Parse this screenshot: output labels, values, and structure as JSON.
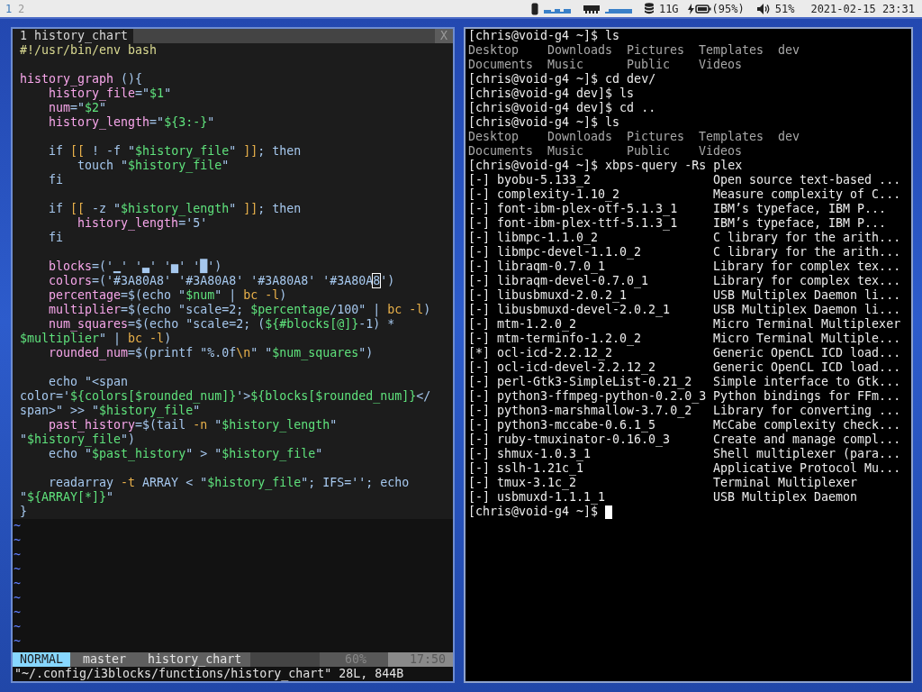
{
  "status_bar": {
    "workspaces": [
      {
        "label": "1",
        "selected": true
      },
      {
        "label": "2",
        "selected": false
      }
    ],
    "disk": "11G",
    "battery": "(95%)",
    "volume": "51%",
    "clock": "2021-02-15 23:31"
  },
  "vim": {
    "tabs": [
      {
        "label": "1 history_chart",
        "selected": true
      }
    ],
    "close": "X",
    "lines": [
      {
        "kind": "code",
        "segments": [
          {
            "kind": "shebang",
            "text": "#!/usr/bin/env bash"
          }
        ]
      },
      {
        "kind": "blank"
      },
      {
        "kind": "code",
        "segments": [
          {
            "kind": "name",
            "text": "history_graph"
          },
          {
            "kind": "plain",
            "text": " (){"
          }
        ]
      },
      {
        "kind": "code",
        "segments": [
          {
            "kind": "name",
            "text": "    history_file"
          },
          {
            "kind": "plain",
            "text": "=\""
          },
          {
            "kind": "string",
            "text": "$1"
          },
          {
            "kind": "plain",
            "text": "\""
          }
        ]
      },
      {
        "kind": "code",
        "segments": [
          {
            "kind": "name",
            "text": "    num"
          },
          {
            "kind": "plain",
            "text": "=\""
          },
          {
            "kind": "string",
            "text": "$2"
          },
          {
            "kind": "plain",
            "text": "\""
          }
        ]
      },
      {
        "kind": "code",
        "segments": [
          {
            "kind": "name",
            "text": "    history_length"
          },
          {
            "kind": "plain",
            "text": "=\""
          },
          {
            "kind": "string",
            "text": "${3:-}"
          },
          {
            "kind": "plain",
            "text": "\""
          }
        ]
      },
      {
        "kind": "blank"
      },
      {
        "kind": "code",
        "segments": [
          {
            "kind": "plain",
            "text": "    if "
          },
          {
            "kind": "flag",
            "text": "[["
          },
          {
            "kind": "plain",
            "text": " ! -f \""
          },
          {
            "kind": "string",
            "text": "$history_file"
          },
          {
            "kind": "plain",
            "text": "\" "
          },
          {
            "kind": "flag",
            "text": "]]"
          },
          {
            "kind": "plain",
            "text": "; then"
          }
        ]
      },
      {
        "kind": "code",
        "segments": [
          {
            "kind": "plain",
            "text": "        touch \""
          },
          {
            "kind": "string",
            "text": "$history_file"
          },
          {
            "kind": "plain",
            "text": "\""
          }
        ]
      },
      {
        "kind": "code",
        "segments": [
          {
            "kind": "plain",
            "text": "    fi"
          }
        ]
      },
      {
        "kind": "blank"
      },
      {
        "kind": "code",
        "segments": [
          {
            "kind": "plain",
            "text": "    if "
          },
          {
            "kind": "flag",
            "text": "[["
          },
          {
            "kind": "plain",
            "text": " -z \""
          },
          {
            "kind": "string",
            "text": "$history_length"
          },
          {
            "kind": "plain",
            "text": "\" "
          },
          {
            "kind": "flag",
            "text": "]]"
          },
          {
            "kind": "plain",
            "text": "; then"
          }
        ]
      },
      {
        "kind": "code",
        "segments": [
          {
            "kind": "name",
            "text": "        history_length"
          },
          {
            "kind": "plain",
            "text": "='5'"
          }
        ]
      },
      {
        "kind": "code",
        "segments": [
          {
            "kind": "plain",
            "text": "    fi"
          }
        ]
      },
      {
        "kind": "blank"
      },
      {
        "kind": "code",
        "segments": [
          {
            "kind": "name",
            "text": "    blocks"
          },
          {
            "kind": "plain",
            "text": "=('▁' '▃' '▅' '█')"
          }
        ]
      },
      {
        "kind": "code",
        "segments": [
          {
            "kind": "name",
            "text": "    colors"
          },
          {
            "kind": "plain",
            "text": "=('#3A80A8' '#3A80A8' '#3A80A8' '#3A80A"
          },
          {
            "kind": "cursor",
            "text": "8"
          },
          {
            "kind": "plain",
            "text": "')"
          }
        ]
      },
      {
        "kind": "code",
        "segments": [
          {
            "kind": "name",
            "text": "    percentage"
          },
          {
            "kind": "plain",
            "text": "=$(echo \""
          },
          {
            "kind": "string",
            "text": "$num"
          },
          {
            "kind": "plain",
            "text": "\" | "
          },
          {
            "kind": "flag",
            "text": "bc -l"
          },
          {
            "kind": "plain",
            "text": ")"
          }
        ]
      },
      {
        "kind": "code",
        "segments": [
          {
            "kind": "name",
            "text": "    multiplier"
          },
          {
            "kind": "plain",
            "text": "=$(echo \"scale=2; "
          },
          {
            "kind": "string",
            "text": "$percentage"
          },
          {
            "kind": "plain",
            "text": "/100\" | "
          },
          {
            "kind": "flag",
            "text": "bc -l"
          },
          {
            "kind": "plain",
            "text": ")"
          }
        ]
      },
      {
        "kind": "code",
        "segments": [
          {
            "kind": "name",
            "text": "    num_squares"
          },
          {
            "kind": "plain",
            "text": "=$(echo \"scale=2; ("
          },
          {
            "kind": "string",
            "text": "${#blocks[@]}"
          },
          {
            "kind": "plain",
            "text": "-1) *"
          }
        ]
      },
      {
        "kind": "code",
        "segments": [
          {
            "kind": "string",
            "text": "$multiplier"
          },
          {
            "kind": "plain",
            "text": "\" | "
          },
          {
            "kind": "flag",
            "text": "bc -l"
          },
          {
            "kind": "plain",
            "text": ")"
          }
        ]
      },
      {
        "kind": "code",
        "segments": [
          {
            "kind": "name",
            "text": "    rounded_num"
          },
          {
            "kind": "plain",
            "text": "=$(printf \"%.0f"
          },
          {
            "kind": "flag",
            "text": "\\n"
          },
          {
            "kind": "plain",
            "text": "\" \""
          },
          {
            "kind": "string",
            "text": "$num_squares"
          },
          {
            "kind": "plain",
            "text": "\")"
          }
        ]
      },
      {
        "kind": "blank"
      },
      {
        "kind": "code",
        "segments": [
          {
            "kind": "plain",
            "text": "    echo \"<span"
          }
        ]
      },
      {
        "kind": "code",
        "segments": [
          {
            "kind": "plain",
            "text": "color='"
          },
          {
            "kind": "string",
            "text": "${colors[$rounded_num]}"
          },
          {
            "kind": "plain",
            "text": "'>"
          },
          {
            "kind": "string",
            "text": "${blocks[$rounded_num]}"
          },
          {
            "kind": "plain",
            "text": "</"
          }
        ]
      },
      {
        "kind": "code",
        "segments": [
          {
            "kind": "plain",
            "text": "span>\" >> \""
          },
          {
            "kind": "string",
            "text": "$history_file"
          },
          {
            "kind": "plain",
            "text": "\""
          }
        ]
      },
      {
        "kind": "code",
        "segments": [
          {
            "kind": "name",
            "text": "    past_history"
          },
          {
            "kind": "plain",
            "text": "=$(tail "
          },
          {
            "kind": "flag",
            "text": "-n"
          },
          {
            "kind": "plain",
            "text": " \""
          },
          {
            "kind": "string",
            "text": "$history_length"
          },
          {
            "kind": "plain",
            "text": "\""
          }
        ]
      },
      {
        "kind": "code",
        "segments": [
          {
            "kind": "plain",
            "text": "\""
          },
          {
            "kind": "string",
            "text": "$history_file"
          },
          {
            "kind": "plain",
            "text": "\")"
          }
        ]
      },
      {
        "kind": "code",
        "segments": [
          {
            "kind": "plain",
            "text": "    echo \""
          },
          {
            "kind": "string",
            "text": "$past_history"
          },
          {
            "kind": "plain",
            "text": "\" > \""
          },
          {
            "kind": "string",
            "text": "$history_file"
          },
          {
            "kind": "plain",
            "text": "\""
          }
        ]
      },
      {
        "kind": "blank"
      },
      {
        "kind": "code",
        "segments": [
          {
            "kind": "plain",
            "text": "    readarray "
          },
          {
            "kind": "flag",
            "text": "-t"
          },
          {
            "kind": "plain",
            "text": " ARRAY < \""
          },
          {
            "kind": "string",
            "text": "$history_file"
          },
          {
            "kind": "plain",
            "text": "\"; IFS=''; echo"
          }
        ]
      },
      {
        "kind": "code",
        "segments": [
          {
            "kind": "plain",
            "text": "\""
          },
          {
            "kind": "string",
            "text": "${ARRAY[*]}"
          },
          {
            "kind": "plain",
            "text": "\""
          }
        ]
      },
      {
        "kind": "code",
        "segments": [
          {
            "kind": "plain",
            "text": "}"
          }
        ]
      }
    ],
    "filler": [
      "~",
      "~",
      "~",
      "~",
      "~",
      "~",
      "~",
      "~",
      "~"
    ],
    "status_line": {
      "mode": "NORMAL",
      "branch": "master",
      "file": "history_chart",
      "percent": "60%",
      "position": "17:50"
    },
    "message": "\"~/.config/i3blocks/functions/history_chart\" 28L, 844B"
  },
  "terminal": {
    "output": [
      {
        "kind": "prompt",
        "text": "[chris@void-g4 ~]$ ls",
        "cursor": false
      },
      {
        "kind": "listing",
        "rows": [
          [
            "Desktop",
            "Downloads",
            "Pictures",
            "Templates",
            "dev"
          ],
          [
            "Documents",
            "Music",
            "Public",
            "Videos"
          ]
        ]
      },
      {
        "kind": "prompt",
        "text": "[chris@void-g4 ~]$ cd dev/",
        "cursor": false
      },
      {
        "kind": "prompt",
        "text": "[chris@void-g4 dev]$ ls",
        "cursor": false
      },
      {
        "kind": "prompt",
        "text": "[chris@void-g4 dev]$ cd ..",
        "cursor": false
      },
      {
        "kind": "prompt",
        "text": "[chris@void-g4 ~]$ ls",
        "cursor": false
      },
      {
        "kind": "listing",
        "rows": [
          [
            "Desktop",
            "Downloads",
            "Pictures",
            "Templates",
            "dev"
          ],
          [
            "Documents",
            "Music",
            "Public",
            "Videos"
          ]
        ]
      },
      {
        "kind": "prompt",
        "text": "[chris@void-g4 ~]$ xbps-query -Rs plex",
        "cursor": false
      },
      {
        "kind": "packages",
        "items": [
          {
            "mark": "[-]",
            "name": "byobu-5.133_2",
            "description": "Open source text-based ..."
          },
          {
            "mark": "[-]",
            "name": "complexity-1.10_2",
            "description": "Measure complexity of C..."
          },
          {
            "mark": "[-]",
            "name": "font-ibm-plex-otf-5.1.3_1",
            "description": "IBM’s typeface, IBM P..."
          },
          {
            "mark": "[-]",
            "name": "font-ibm-plex-ttf-5.1.3_1",
            "description": "IBM’s typeface, IBM P..."
          },
          {
            "mark": "[-]",
            "name": "libmpc-1.1.0_2",
            "description": "C library for the arith..."
          },
          {
            "mark": "[-]",
            "name": "libmpc-devel-1.1.0_2",
            "description": "C library for the arith..."
          },
          {
            "mark": "[-]",
            "name": "libraqm-0.7.0_1",
            "description": "Library for complex tex..."
          },
          {
            "mark": "[-]",
            "name": "libraqm-devel-0.7.0_1",
            "description": "Library for complex tex..."
          },
          {
            "mark": "[-]",
            "name": "libusbmuxd-2.0.2_1",
            "description": "USB Multiplex Daemon li..."
          },
          {
            "mark": "[-]",
            "name": "libusbmuxd-devel-2.0.2_1",
            "description": "USB Multiplex Daemon li..."
          },
          {
            "mark": "[-]",
            "name": "mtm-1.2.0_2",
            "description": "Micro Terminal Multiplexer"
          },
          {
            "mark": "[-]",
            "name": "mtm-terminfo-1.2.0_2",
            "description": "Micro Terminal Multiple..."
          },
          {
            "mark": "[*]",
            "name": "ocl-icd-2.2.12_2",
            "description": "Generic OpenCL ICD load..."
          },
          {
            "mark": "[-]",
            "name": "ocl-icd-devel-2.2.12_2",
            "description": "Generic OpenCL ICD load..."
          },
          {
            "mark": "[-]",
            "name": "perl-Gtk3-SimpleList-0.21_2",
            "description": "Simple interface to Gtk..."
          },
          {
            "mark": "[-]",
            "name": "python3-ffmpeg-python-0.2.0_3",
            "description": "Python bindings for FFm..."
          },
          {
            "mark": "[-]",
            "name": "python3-marshmallow-3.7.0_2",
            "description": "Library for converting ..."
          },
          {
            "mark": "[-]",
            "name": "python3-mccabe-0.6.1_5",
            "description": "McCabe complexity check..."
          },
          {
            "mark": "[-]",
            "name": "ruby-tmuxinator-0.16.0_3",
            "description": "Create and manage compl..."
          },
          {
            "mark": "[-]",
            "name": "shmux-1.0.3_1",
            "description": "Shell multiplexer (para..."
          },
          {
            "mark": "[-]",
            "name": "sslh-1.21c_1",
            "description": "Applicative Protocol Mu..."
          },
          {
            "mark": "[-]",
            "name": "tmux-3.1c_2",
            "description": "Terminal Multiplexer"
          },
          {
            "mark": "[-]",
            "name": "usbmuxd-1.1.1_1",
            "description": "USB Multiplex Daemon"
          }
        ]
      },
      {
        "kind": "prompt",
        "text": "[chris@void-g4 ~]$ ",
        "cursor": true
      }
    ]
  }
}
